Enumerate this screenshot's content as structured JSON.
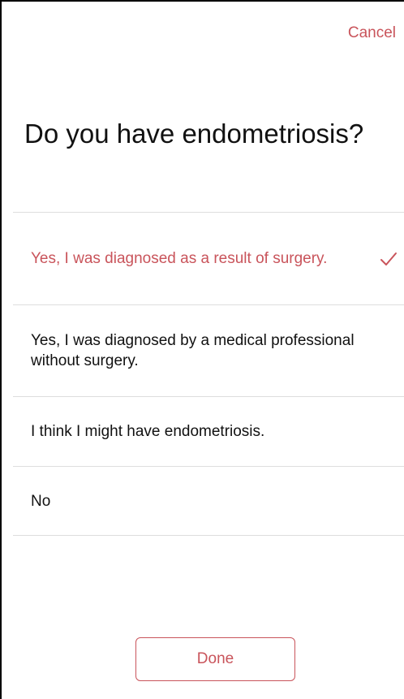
{
  "nav": {
    "cancel_label": "Cancel"
  },
  "question": {
    "title": "Do you have endometriosis?"
  },
  "options": [
    {
      "label": "Yes, I was diagnosed as a result of surgery.",
      "selected": true
    },
    {
      "label": "Yes, I was diagnosed by a medical professional without surgery.",
      "selected": false
    },
    {
      "label": "I think I might have endometriosis.",
      "selected": false
    },
    {
      "label": "No",
      "selected": false
    }
  ],
  "footer": {
    "done_label": "Done"
  },
  "colors": {
    "accent": "#c9545b",
    "text": "#111111",
    "divider": "#dedede"
  },
  "icons": {
    "selected_indicator": "checkmark-icon"
  }
}
